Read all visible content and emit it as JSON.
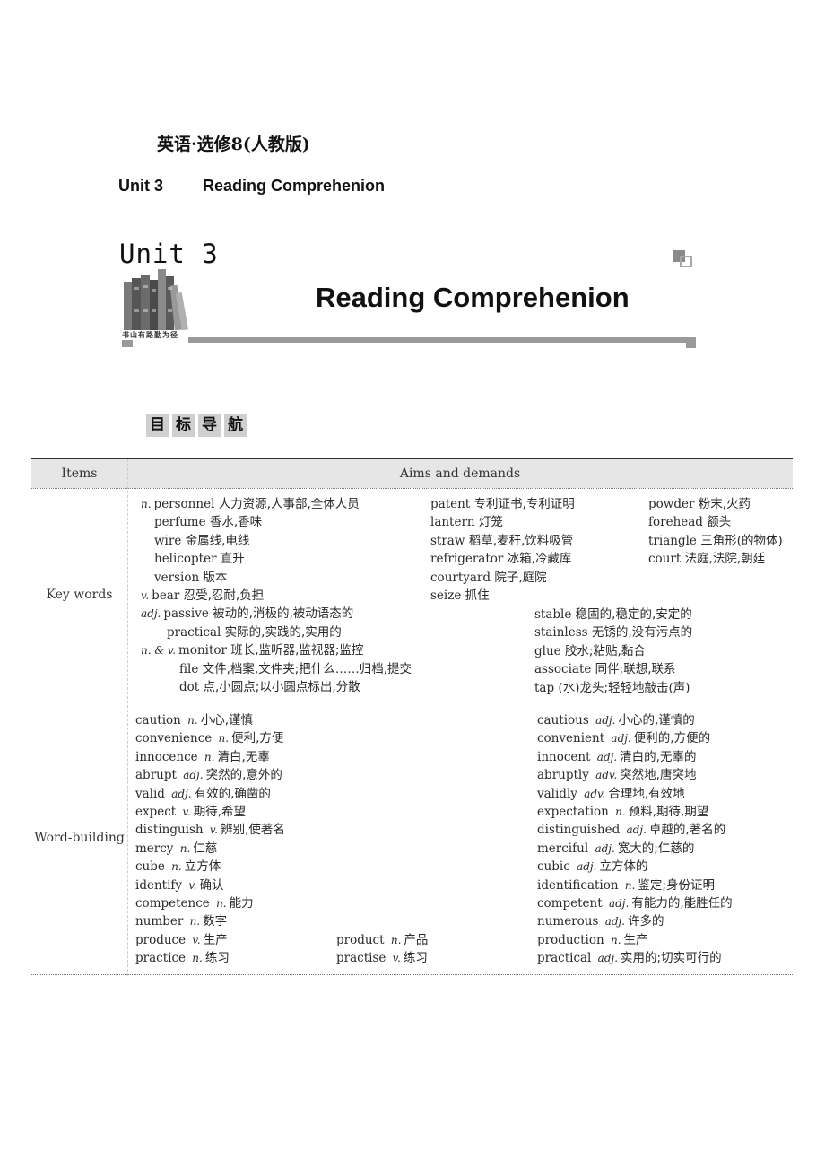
{
  "header": {
    "book_title": "英语·选修8(人教版)",
    "unit_label": "Unit 3",
    "unit_subtitle": "Reading Comprehenion"
  },
  "banner": {
    "unit": "Unit 3",
    "title": "Reading Comprehenion",
    "motto": "书山有路勤为径",
    "icons": [
      "books-image",
      "corner-squares-icon"
    ]
  },
  "section": {
    "title_chars": [
      "目",
      "标",
      "导",
      "航"
    ]
  },
  "table": {
    "headers": [
      "Items",
      "Aims and demands"
    ],
    "key_words": {
      "label": "Key words",
      "col_a": [
        {
          "pos": "n.",
          "word": "personnel",
          "cn": "人力资源,人事部,全体人员"
        },
        {
          "pos": "",
          "word": "perfume",
          "cn": "香水,香味"
        },
        {
          "pos": "",
          "word": "wire",
          "cn": "金属线,电线"
        },
        {
          "pos": "",
          "word": "helicopter",
          "cn": "直升"
        },
        {
          "pos": "",
          "word": "version",
          "cn": "版本"
        },
        {
          "pos": "v.",
          "word": "bear",
          "cn": "忍受,忍耐,负担"
        },
        {
          "pos": "adj.",
          "word": "passive",
          "cn": "被动的,消极的,被动语态的"
        },
        {
          "pos": "",
          "word": "practical",
          "cn": "实际的,实践的,实用的"
        },
        {
          "pos": "n. & v.",
          "word": "monitor",
          "cn": "班长,监听器,监视器;监控"
        },
        {
          "pos": "",
          "word": "file",
          "cn": "文件,档案,文件夹;把什么……归档,提交"
        },
        {
          "pos": "",
          "word": "dot",
          "cn": "点,小圆点;以小圆点标出,分散"
        }
      ],
      "col_b": [
        {
          "word": "patent",
          "cn": "专利证书,专利证明"
        },
        {
          "word": "lantern",
          "cn": "灯笼"
        },
        {
          "word": "straw",
          "cn": "稻草,麦秆,饮料吸管"
        },
        {
          "word": "refrigerator",
          "cn": "冰箱,冷藏库"
        },
        {
          "word": "courtyard",
          "cn": "院子,庭院"
        },
        {
          "word": "seize",
          "cn": "抓住"
        }
      ],
      "col_c": [
        {
          "word": "powder",
          "cn": "粉末,火药"
        },
        {
          "word": "forehead",
          "cn": "额头"
        },
        {
          "word": "triangle",
          "cn": "三角形(的物体)"
        },
        {
          "word": "court",
          "cn": "法庭,法院,朝廷"
        }
      ],
      "col_d": [
        {
          "word": "stable",
          "cn": "稳固的,稳定的,安定的"
        },
        {
          "word": "stainless",
          "cn": "无锈的,没有污点的"
        },
        {
          "word": "glue",
          "cn": "胶水;粘贴,黏合"
        },
        {
          "word": "associate",
          "cn": "同伴;联想,联系"
        },
        {
          "word": "tap",
          "cn": "(水)龙头;轻轻地敲击(声)"
        }
      ]
    },
    "word_building": {
      "label": "Word-building",
      "col_a": [
        {
          "word": "caution",
          "pos": "n.",
          "cn": "小心,谨慎"
        },
        {
          "word": "convenience",
          "pos": "n.",
          "cn": "便利,方便"
        },
        {
          "word": "innocence",
          "pos": "n.",
          "cn": "清白,无辜"
        },
        {
          "word": "abrupt",
          "pos": "adj.",
          "cn": "突然的,意外的"
        },
        {
          "word": "valid",
          "pos": "adj.",
          "cn": "有效的,确凿的"
        },
        {
          "word": "expect",
          "pos": "v.",
          "cn": "期待,希望"
        },
        {
          "word": "distinguish",
          "pos": "v.",
          "cn": "辨别,使著名"
        },
        {
          "word": "mercy",
          "pos": "n.",
          "cn": "仁慈"
        },
        {
          "word": "cube",
          "pos": "n.",
          "cn": "立方体"
        },
        {
          "word": "identify",
          "pos": "v.",
          "cn": "确认"
        },
        {
          "word": "competence",
          "pos": "n.",
          "cn": "能力"
        },
        {
          "word": "number",
          "pos": "n.",
          "cn": "数字"
        },
        {
          "word": "produce",
          "pos": "v.",
          "cn": "生产"
        },
        {
          "word": "practice",
          "pos": "n.",
          "cn": "练习"
        }
      ],
      "col_b": [
        {
          "word": "product",
          "pos": "n.",
          "cn": "产品"
        },
        {
          "word": "practise",
          "pos": "v.",
          "cn": "练习"
        }
      ],
      "col_c": [
        {
          "word": "cautious",
          "pos": "adj.",
          "cn": "小心的,谨慎的"
        },
        {
          "word": "convenient",
          "pos": "adj.",
          "cn": "便利的,方便的"
        },
        {
          "word": "innocent",
          "pos": "adj.",
          "cn": "清白的,无辜的"
        },
        {
          "word": "abruptly",
          "pos": "adv.",
          "cn": "突然地,唐突地"
        },
        {
          "word": "validly",
          "pos": "adv.",
          "cn": "合理地,有效地"
        },
        {
          "word": "expectation",
          "pos": "n.",
          "cn": "预料,期待,期望"
        },
        {
          "word": "distinguished",
          "pos": "adj.",
          "cn": "卓越的,著名的"
        },
        {
          "word": "merciful",
          "pos": "adj.",
          "cn": "宽大的;仁慈的"
        },
        {
          "word": "cubic",
          "pos": "adj.",
          "cn": "立方体的"
        },
        {
          "word": "identification",
          "pos": "n.",
          "cn": "鉴定;身份证明"
        },
        {
          "word": "competent",
          "pos": "adj.",
          "cn": "有能力的,能胜任的"
        },
        {
          "word": "numerous",
          "pos": "adj.",
          "cn": "许多的"
        },
        {
          "word": "production",
          "pos": "n.",
          "cn": "生产"
        },
        {
          "word": "practical",
          "pos": "adj.",
          "cn": "实用的;切实可行的"
        }
      ]
    }
  }
}
